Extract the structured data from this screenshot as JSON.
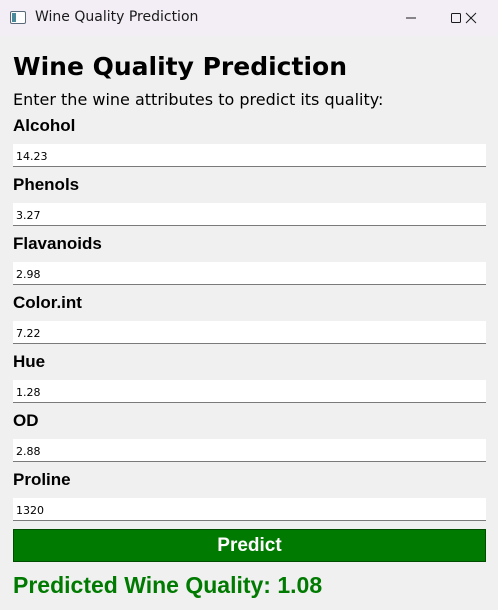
{
  "window": {
    "title": "Wine Quality Prediction",
    "icons": {
      "app": "app-window-icon",
      "minimize": "minimize-icon",
      "maximize": "maximize-icon",
      "close": "close-icon"
    }
  },
  "main": {
    "heading": "Wine Quality Prediction",
    "instructions": "Enter the wine attributes to predict its quality:",
    "fields": [
      {
        "label": "Alcohol",
        "value": "14.23"
      },
      {
        "label": "Phenols",
        "value": "3.27"
      },
      {
        "label": "Flavanoids",
        "value": "2.98"
      },
      {
        "label": "Color.int",
        "value": "7.22"
      },
      {
        "label": "Hue",
        "value": "1.28"
      },
      {
        "label": "OD",
        "value": "2.88"
      },
      {
        "label": "Proline",
        "value": "1320"
      }
    ],
    "predict_button": "Predict",
    "result": "Predicted Wine Quality: 1.08"
  },
  "colors": {
    "accent": "#007a00",
    "window_bg": "#f0f0f0",
    "titlebar_bg": "#f3eef5"
  }
}
